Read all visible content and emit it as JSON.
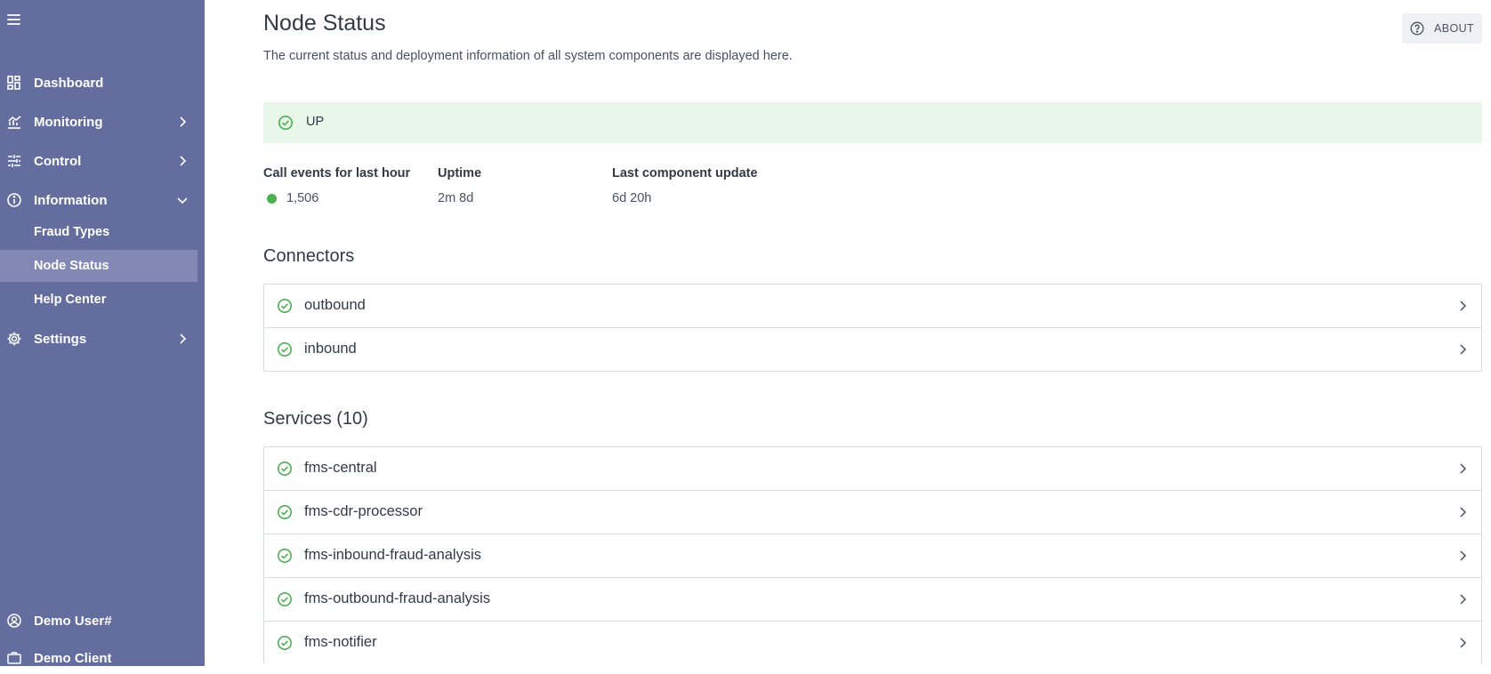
{
  "sidebar": {
    "nav": [
      {
        "label": "Dashboard",
        "icon": "dashboard-icon"
      },
      {
        "label": "Monitoring",
        "icon": "monitoring-icon"
      },
      {
        "label": "Control",
        "icon": "sliders-icon"
      },
      {
        "label": "Information",
        "icon": "info-icon"
      },
      {
        "label": "Settings",
        "icon": "gear-icon"
      }
    ],
    "information_sub": [
      {
        "label": "Fraud Types"
      },
      {
        "label": "Node Status"
      },
      {
        "label": "Help Center"
      }
    ],
    "user": {
      "label": "Demo User#"
    },
    "client": {
      "label": "Demo Client"
    },
    "accent": "#636d9e",
    "active_bg": "#8289b4"
  },
  "header": {
    "title": "Node Status",
    "description": "The current status and deployment information of all system components are displayed here.",
    "about_label": "ABOUT"
  },
  "status": {
    "label": "UP",
    "bg_color": "#e8f7ea",
    "ok_color": "#4caf50"
  },
  "stats": [
    {
      "label": "Call events for last hour",
      "value": "1,506"
    },
    {
      "label": "Uptime",
      "value": "2m 8d"
    },
    {
      "label": "Last component update",
      "value": "6d 20h"
    }
  ],
  "connectors": {
    "title": "Connectors",
    "items": [
      {
        "label": "outbound"
      },
      {
        "label": "inbound"
      }
    ]
  },
  "services": {
    "title": "Services (10)",
    "items": [
      {
        "label": "fms-central"
      },
      {
        "label": "fms-cdr-processor"
      },
      {
        "label": "fms-inbound-fraud-analysis"
      },
      {
        "label": "fms-outbound-fraud-analysis"
      },
      {
        "label": "fms-notifier"
      }
    ]
  }
}
